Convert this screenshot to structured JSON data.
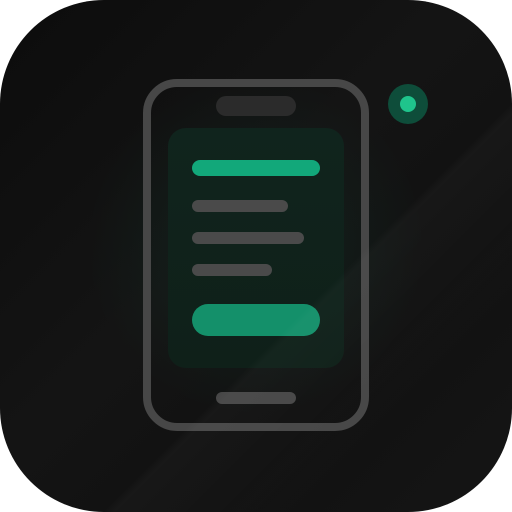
{
  "icon": {
    "depicts": "phone-icon",
    "colors": {
      "background": "#111111",
      "frame": "#474747",
      "accent": "#12a87a",
      "muted_line": "#4a4a4a",
      "status_dot": "#1fc48c"
    }
  },
  "screen": {
    "text_lines": [
      "accent-bar",
      "muted-line",
      "muted-line",
      "muted-line"
    ],
    "cta": "cta-pill"
  },
  "status": {
    "indicator": "notification-dot-icon"
  }
}
